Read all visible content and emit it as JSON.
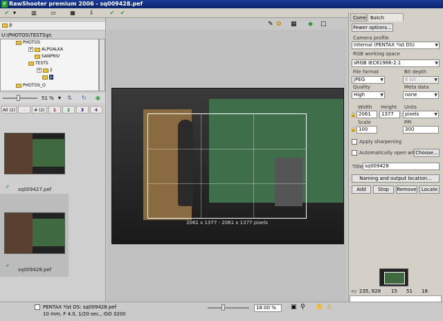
{
  "window": {
    "title": "RawShooter premium 2006 - sq009428.pef",
    "logo": "P"
  },
  "toolbar": {
    "icons": [
      "check-icon",
      "layout-icon",
      "window-icon",
      "print-icon",
      "scan-icon",
      "check-tick-icon",
      "export-icon"
    ]
  },
  "browser": {
    "folder_label": "p",
    "path": "U:\\PHOTOS\\TESTS\\p\\",
    "tree": [
      {
        "label": "PHOTOS",
        "level": 2
      },
      {
        "label": "ALPGALKA",
        "level": 3
      },
      {
        "label": "SANPRIV",
        "level": 3
      },
      {
        "label": "TESTS",
        "level": 2
      },
      {
        "label": "2",
        "level": 3
      },
      {
        "label": "p",
        "level": 4
      },
      {
        "label": "PHOTOS_O",
        "level": 2
      }
    ],
    "zoom": "51 %",
    "filters": [
      "All (2)",
      "-",
      "# (2)",
      "1",
      "2",
      "3",
      "4"
    ]
  },
  "thumbnails": [
    {
      "label": "sq009427.pef"
    },
    {
      "label": "sq009428.pef"
    }
  ],
  "viewer": {
    "crop_label": "2061 x 1377 - 2061 x 1377 pixels"
  },
  "right": {
    "tabs": [
      "Correct",
      "Batch convert"
    ],
    "fewer_options": "Fewer options...",
    "camera_profile_label": "Camera profile",
    "camera_profile": "Internal (PENTAX *ist DS)",
    "rgb_label": "RGB working space",
    "rgb": "sRGB IEC61966-2.1",
    "file_format_label": "File format",
    "file_format": "JPEG",
    "bit_depth_label": "Bit depth",
    "bit_depth": "8 bit",
    "quality_label": "Quality",
    "quality": "High",
    "metadata_label": "Meta data",
    "metadata": "none",
    "width_label": "Width",
    "width": "2061",
    "height_label": "Height",
    "height": "1377",
    "units_label": "Units",
    "units": "pixels",
    "scale_label": "Scale",
    "scale": "100",
    "ppi_label": "PPI",
    "ppi": "300",
    "apply_sharpening": "Apply sharpening",
    "auto_open": "Automatically open with:",
    "choose": "Choose...",
    "title_label": "Title",
    "title_value": "sq009428",
    "naming": "Naming and output location...",
    "add": "Add",
    "stop": "Stop",
    "remove": "Remove",
    "locate": "Locate",
    "readout": {
      "xy": "xy",
      "coords": "235, 828",
      "r": "15",
      "g": "51",
      "b": "18"
    }
  },
  "status": {
    "line1": "PENTAX *ist DS:  sq009428.pef",
    "line2": "10 mm, F 4.0, 1/20 sec., ISO 3200",
    "zoom": "18.00 %"
  },
  "colors": {
    "title": "#0a246a",
    "accent": "#2a9a3a"
  }
}
